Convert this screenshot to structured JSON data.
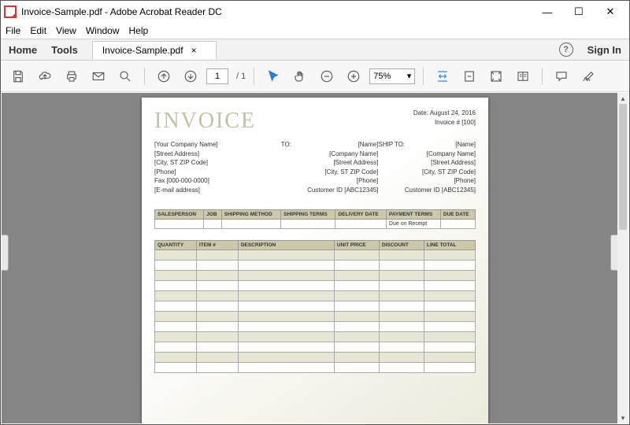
{
  "window": {
    "title": "Invoice-Sample.pdf - Adobe Acrobat Reader DC"
  },
  "menu": {
    "file": "File",
    "edit": "Edit",
    "view": "View",
    "window": "Window",
    "help": "Help"
  },
  "appbar": {
    "home": "Home",
    "tools": "Tools",
    "tab": "Invoice-Sample.pdf",
    "tab_close": "×",
    "signin": "Sign In"
  },
  "toolbar": {
    "page_current": "1",
    "page_total": "/ 1",
    "zoom": "75%"
  },
  "doc": {
    "title": "INVOICE",
    "date_label": "Date:",
    "date": "August 24, 2016",
    "invno_label": "Invoice #",
    "invno": "[100]",
    "from": {
      "company": "[Your Company Name]",
      "street": "[Street Address]",
      "city": "[City, ST  ZIP Code]",
      "phone": "[Phone]",
      "fax": "Fax [000-000-0000]",
      "email": "[E-mail address]"
    },
    "to_label": "TO:",
    "shipto_label": "SHIP TO:",
    "party": {
      "name": "[Name]",
      "company": "[Company Name]",
      "street": "[Street Address]",
      "city": "[City, ST  ZIP Code]",
      "phone": "[Phone]",
      "cust": "Customer ID [ABC12345]"
    },
    "grid_headers": {
      "salesperson": "Salesperson",
      "job": "Job",
      "shipmethod": "Shipping Method",
      "shipterms": "Shipping Terms",
      "delivery": "Delivery Date",
      "payterms": "Payment Terms",
      "duedate": "Due Date"
    },
    "grid_values": {
      "payterms": "Due on Receipt"
    },
    "item_headers": {
      "qty": "Quantity",
      "item": "Item #",
      "desc": "Description",
      "unit": "Unit Price",
      "disc": "Discount",
      "total": "Line Total"
    }
  }
}
